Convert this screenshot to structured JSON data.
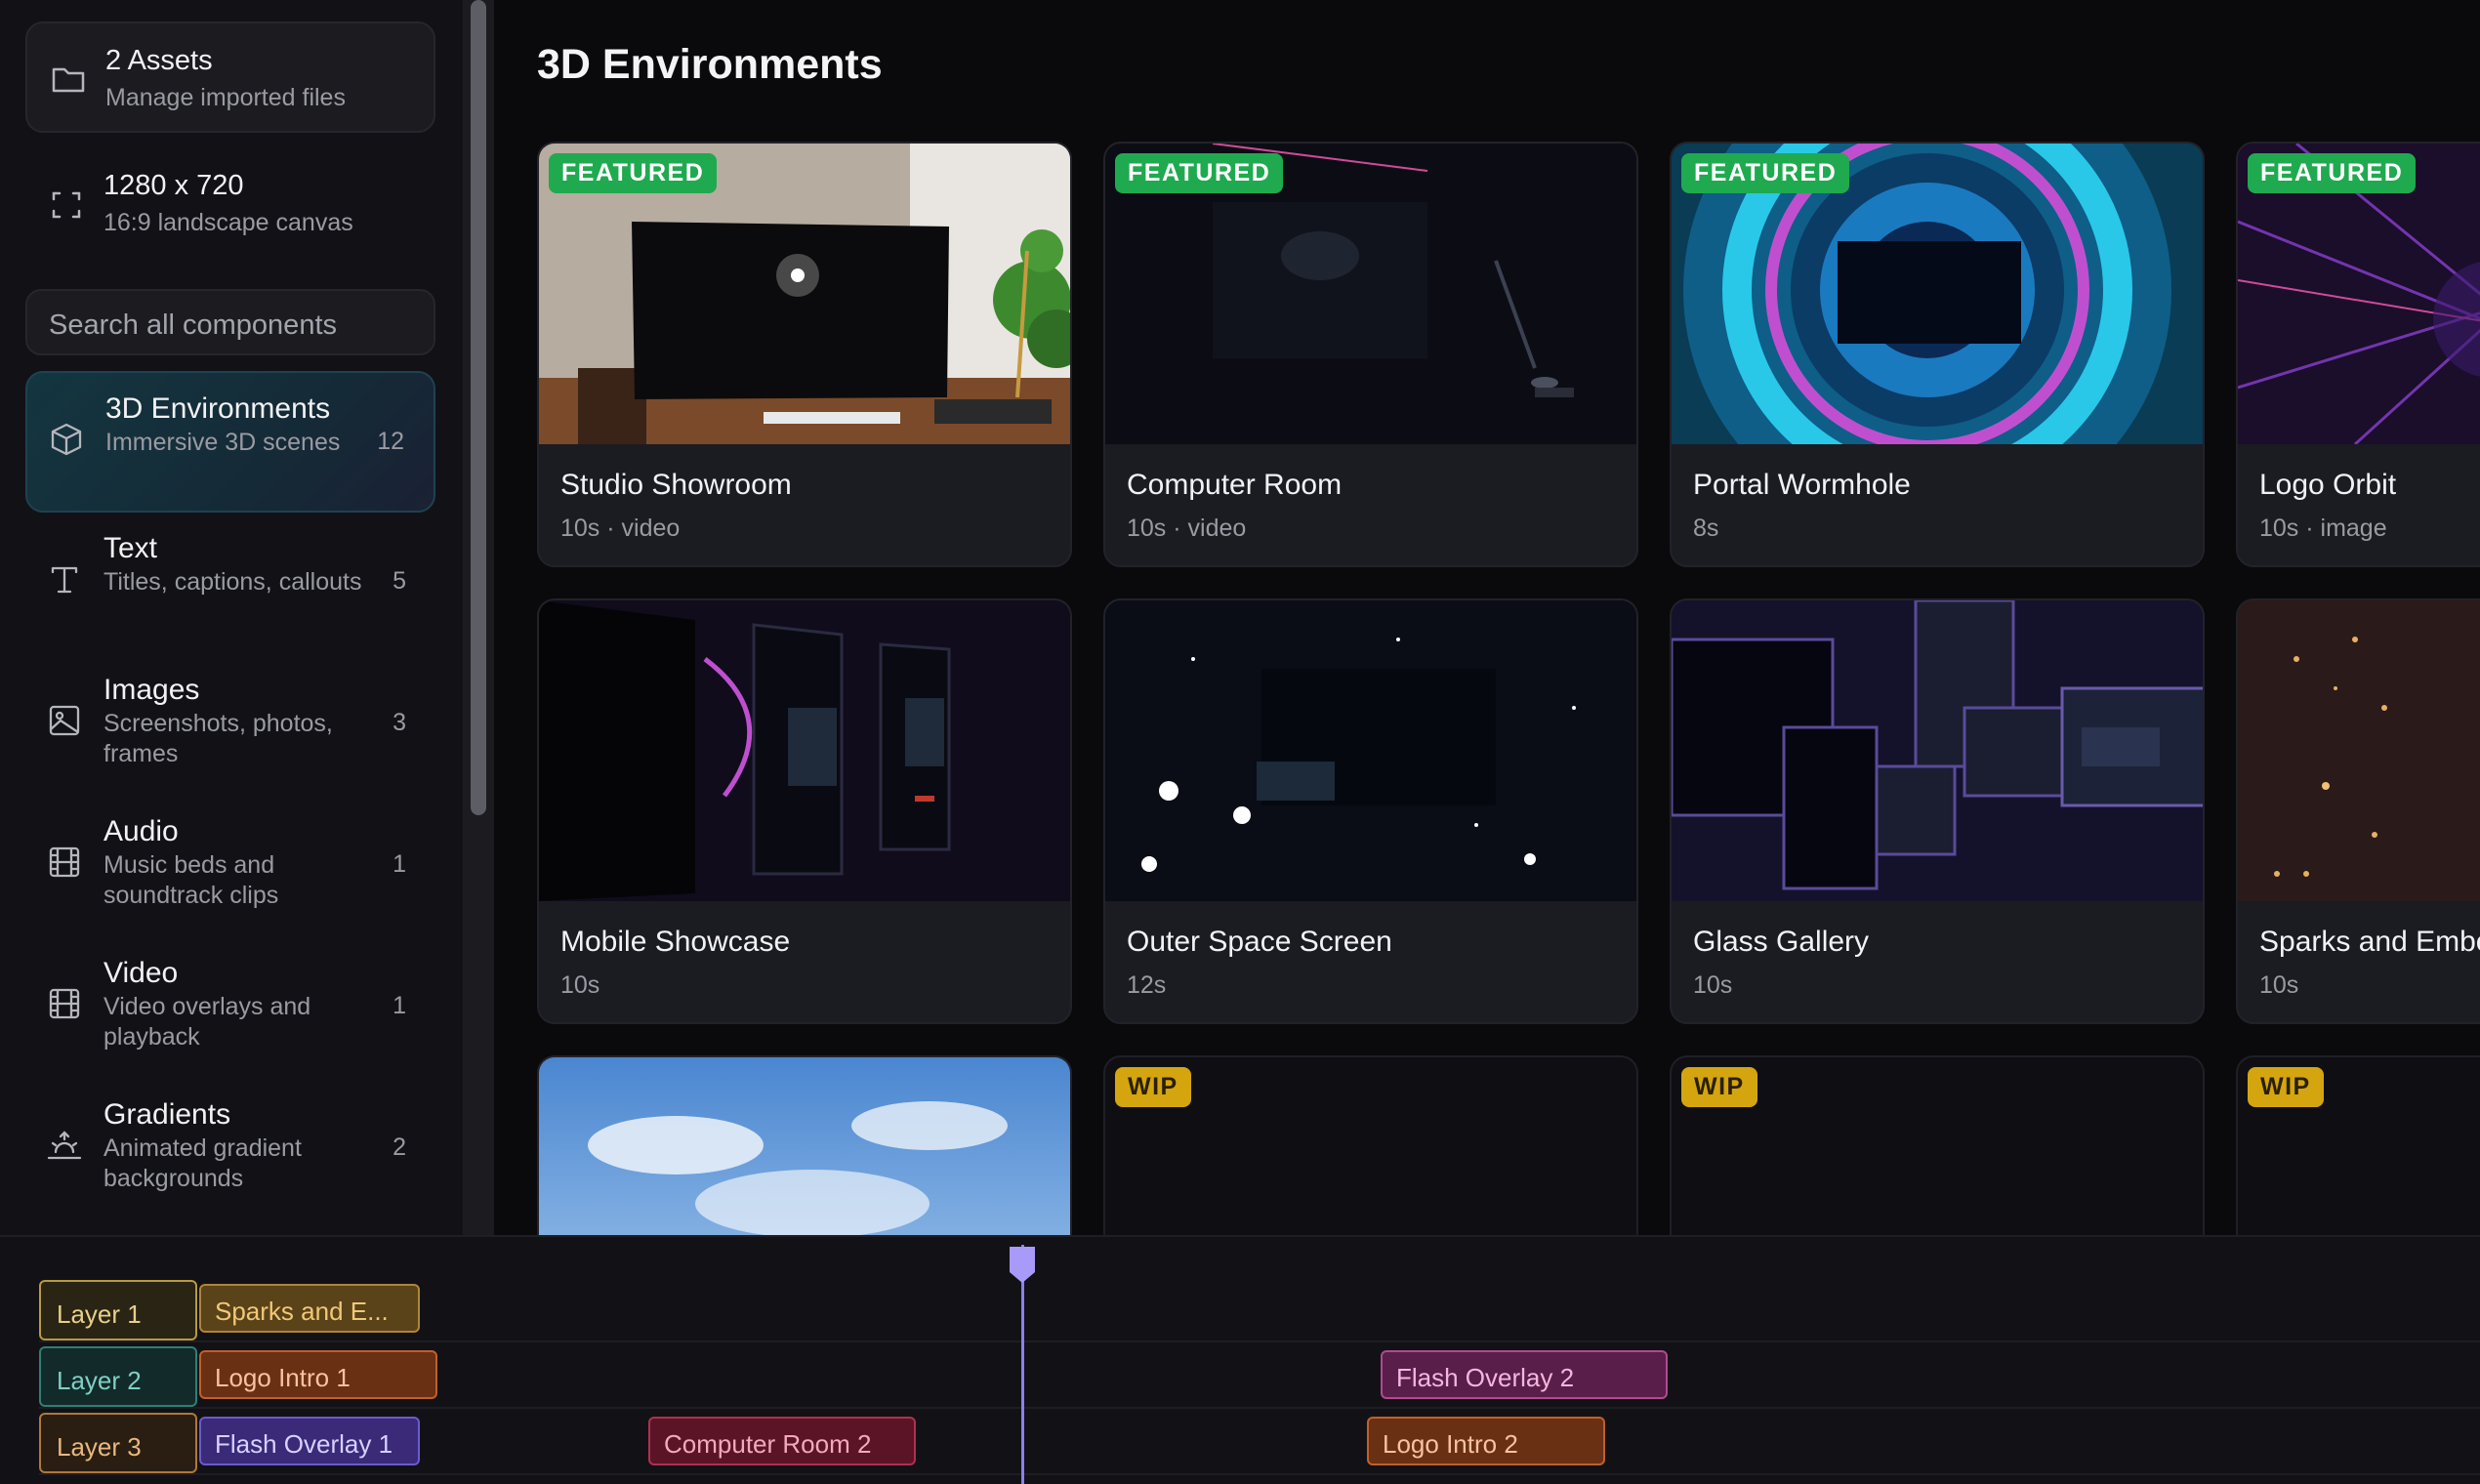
{
  "assets_card": {
    "title": "2 Assets",
    "subtitle": "Manage imported files",
    "icon": "folder-icon"
  },
  "canvas_card": {
    "title": "1280 x 720",
    "subtitle": "16:9 landscape canvas",
    "icon": "fullscreen-frame-icon"
  },
  "search": {
    "placeholder": "Search all components"
  },
  "categories": [
    {
      "name": "3D Environments",
      "desc": "Immersive 3D scenes",
      "count": "12",
      "icon": "cube-icon",
      "active": true
    },
    {
      "name": "Text",
      "desc": "Titles, captions, callouts",
      "count": "5",
      "icon": "text-icon"
    },
    {
      "name": "Images",
      "desc": "Screenshots, photos, frames",
      "count": "3",
      "icon": "image-icon"
    },
    {
      "name": "Audio",
      "desc": "Music beds and soundtrack clips",
      "count": "1",
      "icon": "film-icon"
    },
    {
      "name": "Video",
      "desc": "Video overlays and playback",
      "count": "1",
      "icon": "film-icon"
    },
    {
      "name": "Gradients",
      "desc": "Animated gradient backgrounds",
      "count": "2",
      "icon": "sunrise-icon"
    }
  ],
  "main": {
    "title": "3D Environments",
    "tiles": [
      {
        "name": "Studio Showroom",
        "meta": "10s · video",
        "badge": "FEATURED"
      },
      {
        "name": "Computer Room",
        "meta": "10s · video",
        "badge": "FEATURED"
      },
      {
        "name": "Portal Wormhole",
        "meta": "8s",
        "badge": "FEATURED"
      },
      {
        "name": "Logo Orbit",
        "meta": "10s · image",
        "badge": "FEATURED"
      },
      {
        "name": "Mobile Showcase",
        "meta": "10s",
        "badge": ""
      },
      {
        "name": "Outer Space Screen",
        "meta": "12s",
        "badge": ""
      },
      {
        "name": "Glass Gallery",
        "meta": "10s",
        "badge": ""
      },
      {
        "name": "Sparks and Embe",
        "meta": "10s",
        "badge": ""
      },
      {
        "name": "",
        "meta": "",
        "badge": ""
      },
      {
        "name": "",
        "meta": "",
        "badge": "WIP"
      },
      {
        "name": "",
        "meta": "",
        "badge": "WIP"
      },
      {
        "name": "",
        "meta": "",
        "badge": "WIP"
      }
    ]
  },
  "timeline": {
    "layers": [
      {
        "label": "Layer 1",
        "clips": [
          "Sparks and E..."
        ]
      },
      {
        "label": "Layer 2",
        "clips": [
          "Logo Intro 1",
          "Flash Overlay 2"
        ]
      },
      {
        "label": "Layer 3",
        "clips": [
          "Flash Overlay 1",
          "Computer Room 2",
          "Logo Intro 2"
        ]
      }
    ]
  },
  "colors": {
    "accent_active": "#133640",
    "badge_featured": "#1faa4f",
    "badge_wip": "#d4a50f",
    "playhead": "#8b7ff2"
  }
}
